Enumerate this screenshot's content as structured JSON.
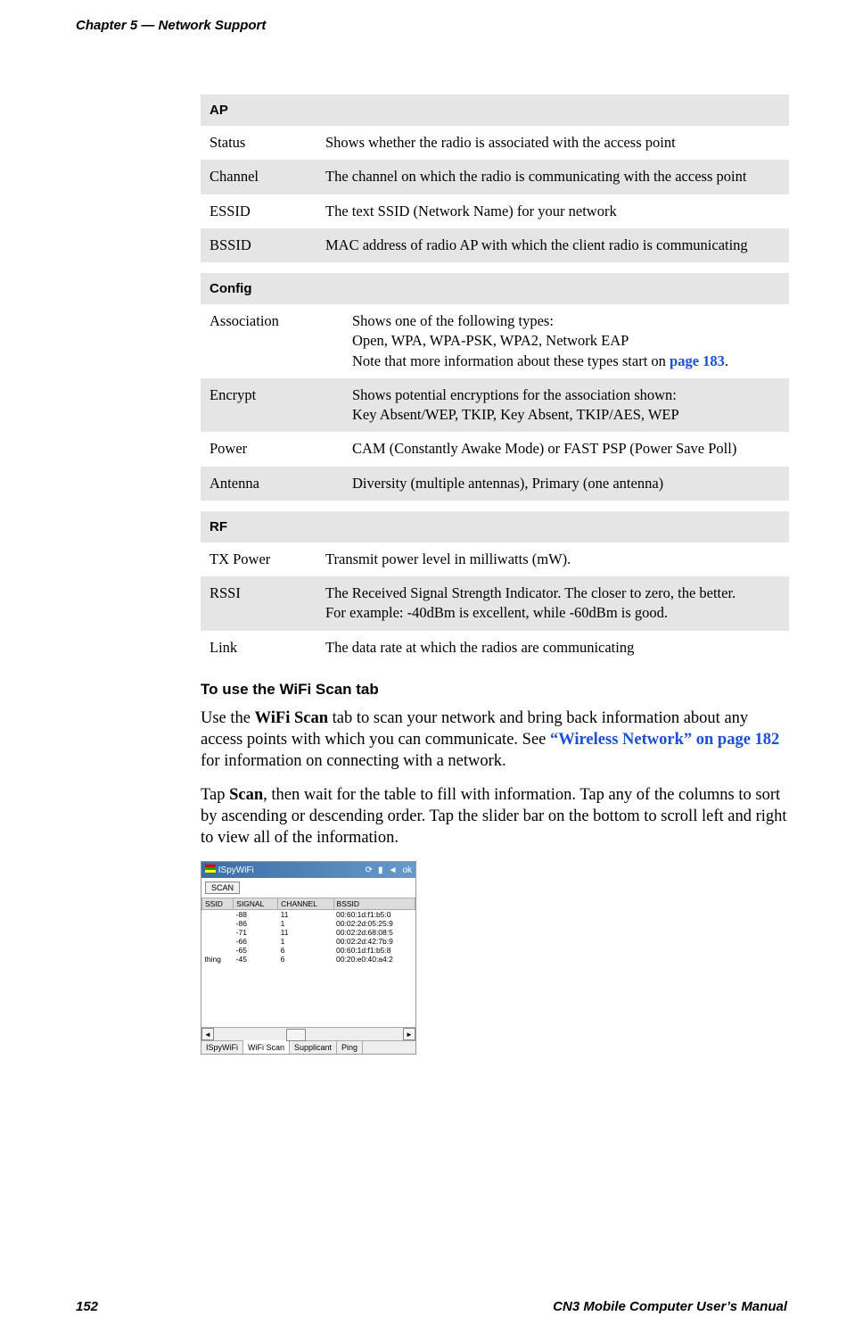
{
  "header": {
    "title": "Chapter 5 — Network Support"
  },
  "tables": {
    "ap": {
      "heading": "AP",
      "rows": [
        {
          "key": "Status",
          "val": "Shows whether the radio is associated with the access point"
        },
        {
          "key": "Channel",
          "val": "The channel on which the radio is communicating with the access point"
        },
        {
          "key": "ESSID",
          "val": "The text SSID (Network Name) for your network"
        },
        {
          "key": "BSSID",
          "val": "MAC address of radio AP with which the client radio is communicating"
        }
      ]
    },
    "config": {
      "heading": "Config",
      "rows": [
        {
          "key": "Association",
          "val_line1": "Shows one of the following types:",
          "val_line2": "Open, WPA, WPA-PSK, WPA2, Network EAP",
          "val_line3_prefix": "Note that more information about these types start on ",
          "val_line3_link": "page 183",
          "val_line3_suffix": "."
        },
        {
          "key": "Encrypt",
          "val_line1": "Shows potential encryptions for the association shown:",
          "val_line2": "Key Absent/WEP, TKIP, Key Absent, TKIP/AES, WEP"
        },
        {
          "key": "Power",
          "val": "CAM (Constantly Awake Mode) or FAST PSP (Power Save Poll)"
        },
        {
          "key": "Antenna",
          "val": "Diversity (multiple antennas), Primary (one antenna)"
        }
      ]
    },
    "rf": {
      "heading": "RF",
      "rows": [
        {
          "key": "TX Power",
          "val": "Transmit power level in milliwatts (mW)."
        },
        {
          "key": "RSSI",
          "val_line1": "The Received Signal Strength Indicator. The closer to zero, the better.",
          "val_line2": "For example: -40dBm is excellent, while -60dBm is good."
        },
        {
          "key": "Link",
          "val": "The data rate at which the radios are communicating"
        }
      ]
    }
  },
  "section_heading": "To use the WiFi Scan tab",
  "para1": {
    "p1": "Use the ",
    "b1": "WiFi Scan",
    "p2": " tab to scan your network and bring back information about any access points with which you can communicate. See ",
    "link": "“Wireless Network” on page 182",
    "p3": " for information on connecting with a network."
  },
  "para2": {
    "p1": "Tap ",
    "b1": "Scan",
    "p2": ", then wait for the table to fill with information. Tap any of the columns to sort by ascending or descending order. Tap the slider bar on the bottom to scroll left and right to view all of the information."
  },
  "screenshot": {
    "title": "ISpyWiFi",
    "ok": "ok",
    "scan_btn": "SCAN",
    "columns": [
      "SSID",
      "SIGNAL",
      "CHANNEL",
      "BSSID"
    ],
    "rows": [
      {
        "ssid": "",
        "signal": "-88",
        "channel": "11",
        "bssid": "00:60:1d:f1:b5:0"
      },
      {
        "ssid": "",
        "signal": "-86",
        "channel": "1",
        "bssid": "00:02:2d:05:25:9"
      },
      {
        "ssid": "",
        "signal": "-71",
        "channel": "11",
        "bssid": "00:02:2d:68:08:5"
      },
      {
        "ssid": "",
        "signal": "-66",
        "channel": "1",
        "bssid": "00:02:2d:42:7b:9"
      },
      {
        "ssid": "",
        "signal": "-65",
        "channel": "6",
        "bssid": "00:60:1d:f1:b5:8"
      },
      {
        "ssid": "thing",
        "signal": "-45",
        "channel": "6",
        "bssid": "00:20:e0:40:a4:2"
      }
    ],
    "tabs": [
      "ISpyWiFi",
      "WiFi Scan",
      "Supplicant",
      "Ping"
    ],
    "active_tab": 1
  },
  "footer": {
    "page": "152",
    "manual": "CN3 Mobile Computer User’s Manual"
  }
}
